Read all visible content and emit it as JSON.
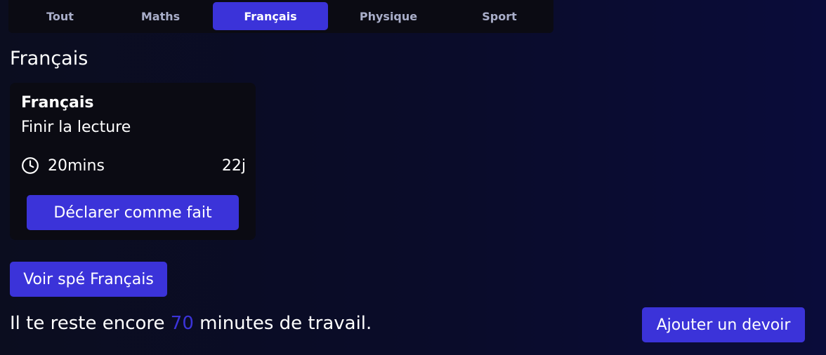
{
  "tabs": [
    {
      "label": "Tout",
      "active": false
    },
    {
      "label": "Maths",
      "active": false
    },
    {
      "label": "Français",
      "active": true
    },
    {
      "label": "Physique",
      "active": false
    },
    {
      "label": "Sport",
      "active": false
    }
  ],
  "section": {
    "title": "Français"
  },
  "task_card": {
    "subject": "Français",
    "description": "Finir la lecture",
    "duration": "20mins",
    "due": "22j",
    "duration_icon": "clock-icon",
    "done_button_label": "Déclarer comme fait"
  },
  "voir_button_label": "Voir spé Français",
  "remaining": {
    "prefix": "Il te reste encore ",
    "minutes": "70",
    "suffix": " minutes de travail."
  },
  "add_button_label": "Ajouter un devoir",
  "colors": {
    "accent": "#3b33d9",
    "card_background": "#0b0b13",
    "inactive_tab_text": "#a9aec9"
  }
}
